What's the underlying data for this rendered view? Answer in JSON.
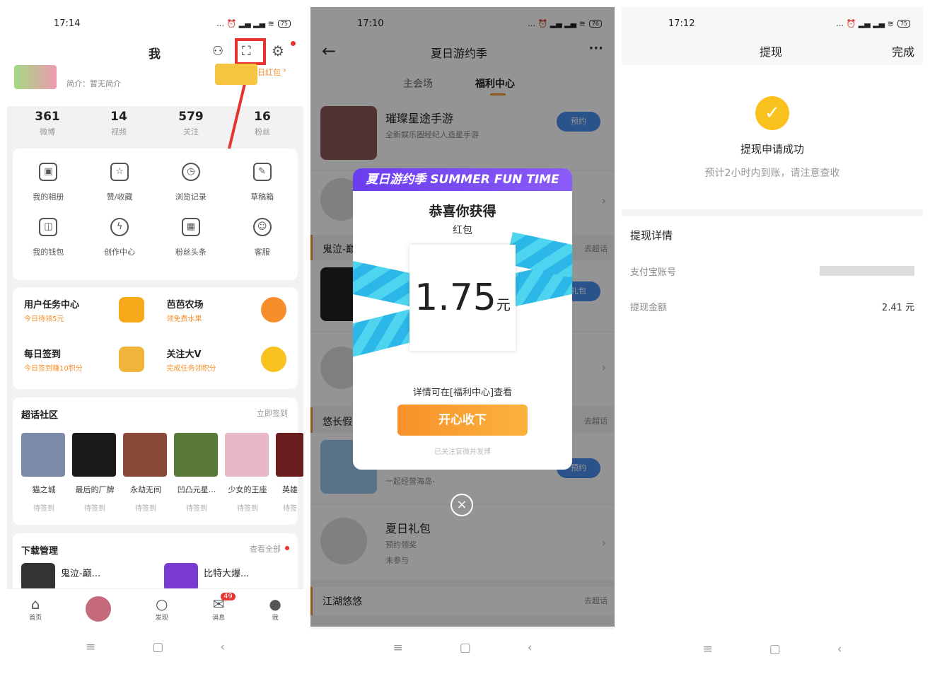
{
  "p1": {
    "time": "17:14",
    "battery": "75",
    "title": "我",
    "bio": "简介：暂无简介",
    "redpacket_text": "日红包",
    "stats": [
      {
        "num": "361",
        "label": "微博"
      },
      {
        "num": "14",
        "label": "视频"
      },
      {
        "num": "579",
        "label": "关注"
      },
      {
        "num": "16",
        "label": "粉丝"
      }
    ],
    "grid": [
      {
        "label": "我的相册",
        "icon": "photo-icon"
      },
      {
        "label": "赞/收藏",
        "icon": "star-icon"
      },
      {
        "label": "浏览记录",
        "icon": "clock-icon"
      },
      {
        "label": "草稿箱",
        "icon": "draft-icon"
      },
      {
        "label": "我的钱包",
        "icon": "wallet-icon"
      },
      {
        "label": "创作中心",
        "icon": "bulb-icon"
      },
      {
        "label": "粉丝头条",
        "icon": "calendar-icon"
      },
      {
        "label": "客服",
        "icon": "service-icon"
      }
    ],
    "tasks": [
      {
        "title": "用户任务中心",
        "sub": "今日待领5元"
      },
      {
        "title": "芭芭农场",
        "sub": "领免费水果"
      },
      {
        "title": "每日签到",
        "sub": "今日签到赚10积分"
      },
      {
        "title": "关注大V",
        "sub": "完成任务领积分"
      }
    ],
    "community": {
      "title": "超话社区",
      "action": "立即签到",
      "items": [
        {
          "name": "猫之城",
          "status": "待签到"
        },
        {
          "name": "最后的厂牌",
          "status": "待签到"
        },
        {
          "name": "永劫无间",
          "status": "待签到"
        },
        {
          "name": "凹凸元星...",
          "status": "待签到"
        },
        {
          "name": "少女的王座",
          "status": "待签到"
        },
        {
          "name": "英雄",
          "status": "待签"
        }
      ]
    },
    "download": {
      "title": "下载管理",
      "action": "查看全部",
      "items": [
        "鬼泣-巅...",
        "比特大爆..."
      ]
    },
    "tabs": [
      "首页",
      "",
      "发现",
      "消息",
      "我"
    ],
    "badge": "49"
  },
  "p2": {
    "time": "17:10",
    "battery": "76",
    "title": "夏日游约季",
    "menu": "···",
    "tab_main": "主会场",
    "tab_welfare": "福利中心",
    "game1": {
      "title": "璀璨星途手游",
      "sub": "全新娱乐圈经纪人造星手游",
      "btn": "预约"
    },
    "sec1": "鬼泣-巅",
    "sec2": "悠长假",
    "sec3": "江湖悠悠",
    "goto": "去超话",
    "bottom_sub": "一起经营海岛-",
    "summer_gift": {
      "title": "夏日礼包",
      "sub": "预约领奖",
      "status": "未参与"
    },
    "giftbtn": "礼包",
    "prebtn": "预约",
    "modal": {
      "banner": "夏日游约季 SUMMER FUN TIME",
      "congrats": "恭喜你获得",
      "type": "红包",
      "amount": "1.75",
      "unit": "元",
      "detail": "详情可在[福利中心]查看",
      "btn": "开心收下",
      "note": "已关注官微并发博"
    }
  },
  "p3": {
    "time": "17:12",
    "battery": "75",
    "title": "提现",
    "done": "完成",
    "success": "提现申请成功",
    "hint": "预计2小时内到账，请注意查收",
    "detail_title": "提现详情",
    "alipay": "支付宝账号",
    "amount_label": "提现金额",
    "amount": "2.41 元"
  },
  "colors": {
    "orange": "#f7912b",
    "blue": "#4a8ff0",
    "purple": "#6a3df0",
    "check": "#f9c21e"
  }
}
